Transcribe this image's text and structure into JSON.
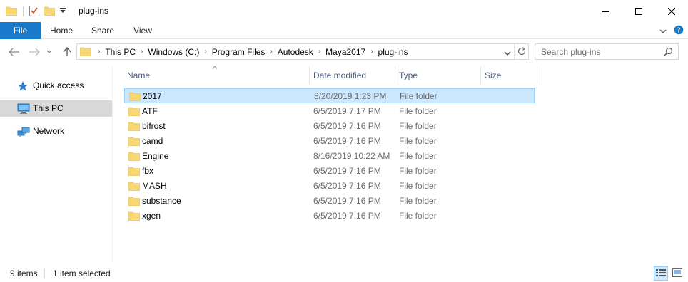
{
  "window": {
    "title": "plug-ins"
  },
  "ribbon": {
    "tabs": [
      "File",
      "Home",
      "Share",
      "View"
    ]
  },
  "address": {
    "crumbs": [
      "This PC",
      "Windows (C:)",
      "Program Files",
      "Autodesk",
      "Maya2017",
      "plug-ins"
    ]
  },
  "search": {
    "placeholder": "Search plug-ins"
  },
  "navpane": {
    "items": [
      {
        "label": "Quick access",
        "icon": "star-icon"
      },
      {
        "label": "This PC",
        "icon": "computer-icon"
      },
      {
        "label": "Network",
        "icon": "network-icon"
      }
    ]
  },
  "columns": {
    "name": "Name",
    "date": "Date modified",
    "type": "Type",
    "size": "Size"
  },
  "files": [
    {
      "name": "2017",
      "date": "8/20/2019 1:23 PM",
      "type": "File folder"
    },
    {
      "name": "ATF",
      "date": "6/5/2019 7:17 PM",
      "type": "File folder"
    },
    {
      "name": "bifrost",
      "date": "6/5/2019 7:16 PM",
      "type": "File folder"
    },
    {
      "name": "camd",
      "date": "6/5/2019 7:16 PM",
      "type": "File folder"
    },
    {
      "name": "Engine",
      "date": "8/16/2019 10:22 AM",
      "type": "File folder"
    },
    {
      "name": "fbx",
      "date": "6/5/2019 7:16 PM",
      "type": "File folder"
    },
    {
      "name": "MASH",
      "date": "6/5/2019 7:16 PM",
      "type": "File folder"
    },
    {
      "name": "substance",
      "date": "6/5/2019 7:16 PM",
      "type": "File folder"
    },
    {
      "name": "xgen",
      "date": "6/5/2019 7:16 PM",
      "type": "File folder"
    }
  ],
  "status": {
    "count": "9 items",
    "selected": "1 item selected"
  },
  "colors": {
    "accent": "#1979ca",
    "selection": "#cce8ff",
    "selection_border": "#99d1ff",
    "folder": "#f8d775"
  }
}
